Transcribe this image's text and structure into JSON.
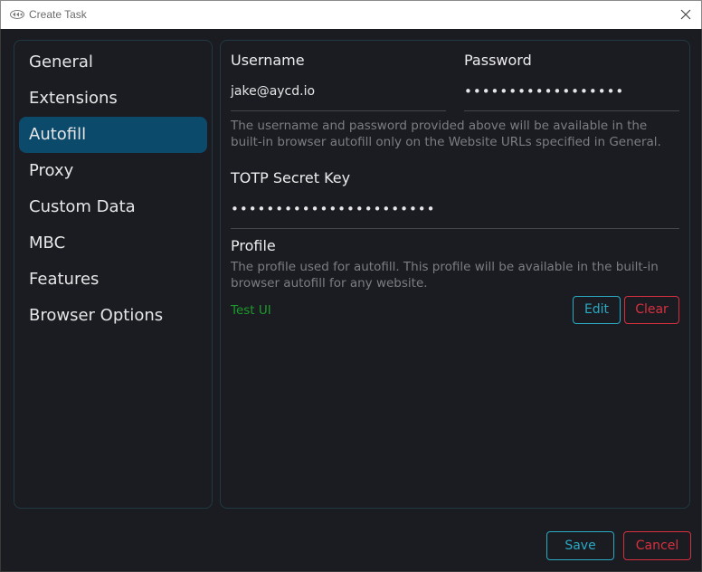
{
  "window": {
    "title": "Create Task"
  },
  "sidebar": {
    "items": [
      {
        "label": "General"
      },
      {
        "label": "Extensions"
      },
      {
        "label": "Autofill",
        "active": true
      },
      {
        "label": "Proxy"
      },
      {
        "label": "Custom Data"
      },
      {
        "label": "MBC"
      },
      {
        "label": "Features"
      },
      {
        "label": "Browser Options"
      }
    ]
  },
  "autofill": {
    "username_label": "Username",
    "username_value": "jake@aycd.io",
    "password_label": "Password",
    "password_value": "••••••••••••••••••",
    "credentials_help": "The username and password provided above will be available in the built-in browser autofill only on the Website URLs specified in General.",
    "totp_label": "TOTP Secret Key",
    "totp_value": "•••••••••••••••••••••••",
    "profile_label": "Profile",
    "profile_help": "The profile used for autofill. This profile will be available in the built-in browser autofill for any website.",
    "profile_value": "Test UI",
    "edit_label": "Edit",
    "clear_label": "Clear"
  },
  "footer": {
    "save_label": "Save",
    "cancel_label": "Cancel"
  },
  "colors": {
    "accent": "#2aa9c3",
    "danger": "#d6303f",
    "active_nav": "#0c4a6b",
    "profile_text": "#1d9a2a"
  }
}
